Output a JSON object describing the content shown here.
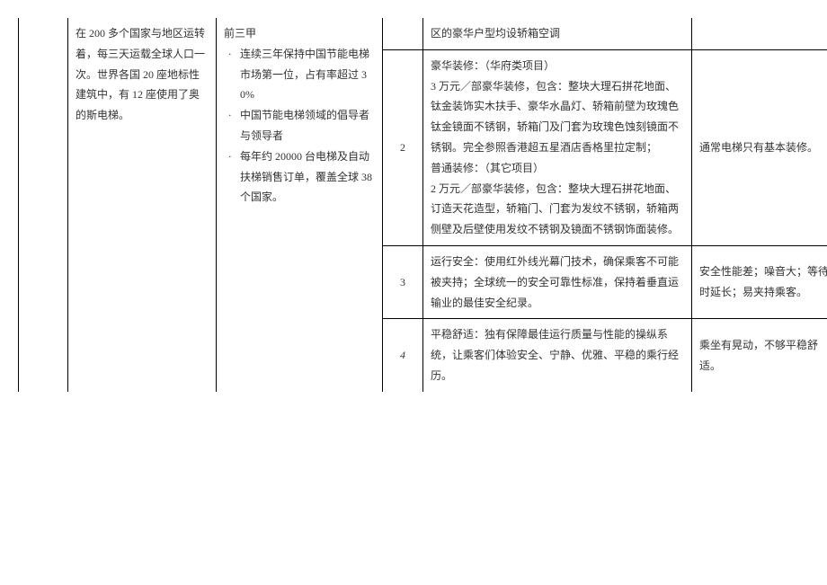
{
  "left": {
    "col0": "",
    "col1": "在 200 多个国家与地区运转着，每三天运载全球人口一次。世界各国 20 座地标性建筑中，有 12 座使用了奥的斯电梯。",
    "col2_intro": "前三甲",
    "col2_b1": "连续三年保持中国节能电梯市场第一位，占有率超过 30%",
    "col2_b2": "中国节能电梯领域的倡导者与领导者",
    "col2_b3": "每年约 20000 台电梯及自动扶梯销售订单，覆盖全球 38 个国家。"
  },
  "rows": [
    {
      "num": "",
      "feature": "区的豪华户型均设轿箱空调",
      "note": ""
    },
    {
      "num": "2",
      "feature": "豪华装修：（华府类项目）\n3 万元／部豪华装修，包含：整块大理石拼花地面、钛金装饰实木扶手、豪华水晶灯、轿箱前壁为玫瑰色钛金镜面不锈钢，轿箱门及门套为玫瑰色蚀刻镜面不锈钢。完全参照香港超五星酒店香格里拉定制；\n普通装修：（其它项目）\n2 万元／部豪华装修，包含：整块大理石拼花地面、订造天花造型，轿箱门、门套为发纹不锈钢，轿箱两侧壁及后壁使用发纹不锈钢及镜面不锈钢饰面装修。",
      "note": "通常电梯只有基本装修。"
    },
    {
      "num": "3",
      "feature": "运行安全：使用红外线光幕门技术，确保乘客不可能被夹持；全球统一的安全可靠性标准，保持着垂直运输业的最佳安全纪录。",
      "note": "安全性能差；噪音大；等待时延长；易夹持乘客。"
    },
    {
      "num": "4",
      "feature": "平稳舒适：独有保障最佳运行质量与性能的操纵系统，让乘客们体验安全、宁静、优雅、平稳的乘行经历。",
      "note": "乘坐有晃动，不够平稳舒适。"
    }
  ]
}
